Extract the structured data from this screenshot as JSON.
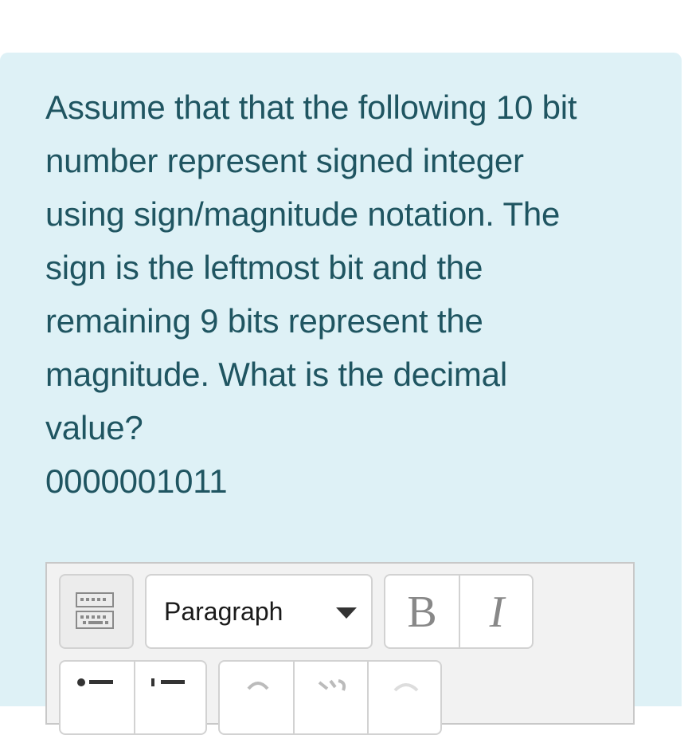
{
  "question": {
    "lines": [
      "Assume that that the following 10 bit",
      "number represent signed integer",
      "using sign/magnitude notation. The",
      "sign is the leftmost bit and the",
      "remaining 9 bits represent the",
      "magnitude. What is the decimal",
      "value?",
      "0000001011"
    ]
  },
  "editor": {
    "format_select_value": "Paragraph",
    "bold_label": "B",
    "italic_label": "I",
    "icons": [
      "keyboard-toggle-icon",
      "bullet-list-icon",
      "numbered-list-icon",
      "link-icon",
      "unlink-icon",
      "image-icon"
    ]
  },
  "colors": {
    "panel_bg": "#def1f6",
    "question_text": "#1f5561"
  }
}
